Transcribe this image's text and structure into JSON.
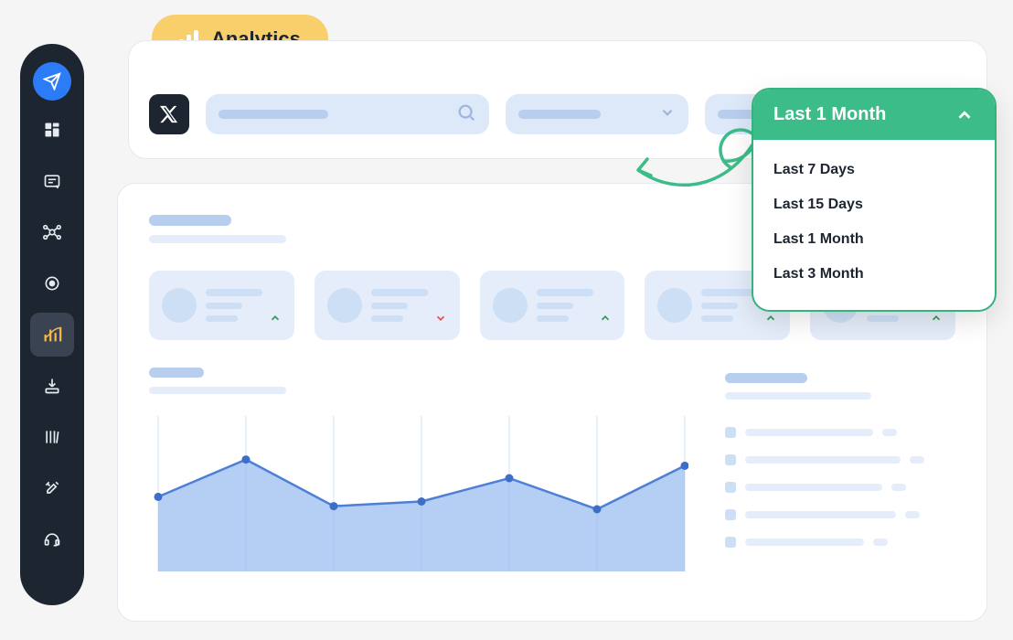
{
  "pill": {
    "label": "Analytics"
  },
  "sidebar": {
    "items": [
      {
        "icon": "send"
      },
      {
        "icon": "dashboard"
      },
      {
        "icon": "inbox"
      },
      {
        "icon": "network"
      },
      {
        "icon": "target"
      },
      {
        "icon": "analytics"
      },
      {
        "icon": "download"
      },
      {
        "icon": "library"
      },
      {
        "icon": "tools"
      },
      {
        "icon": "headset"
      }
    ]
  },
  "date_filter": {
    "selected": "Last 1 Month",
    "options": [
      "Last 7 Days",
      "Last 15 Days",
      "Last 1 Month",
      "Last 3 Month"
    ]
  },
  "stat_cards": [
    {
      "trend": "up"
    },
    {
      "trend": "down"
    },
    {
      "trend": "up"
    },
    {
      "trend": "up"
    },
    {
      "trend": "up"
    }
  ],
  "chart_data": {
    "type": "area",
    "x": [
      1,
      2,
      3,
      4,
      5,
      6,
      7
    ],
    "values": [
      48,
      72,
      42,
      45,
      60,
      40,
      68
    ],
    "ylim": [
      0,
      100
    ],
    "title": "",
    "xlabel": "",
    "ylabel": ""
  },
  "colors": {
    "accent_green": "#3cbc88",
    "accent_yellow": "#f9cf6b",
    "accent_blue": "#6fa0ec",
    "danger": "#e05454"
  }
}
